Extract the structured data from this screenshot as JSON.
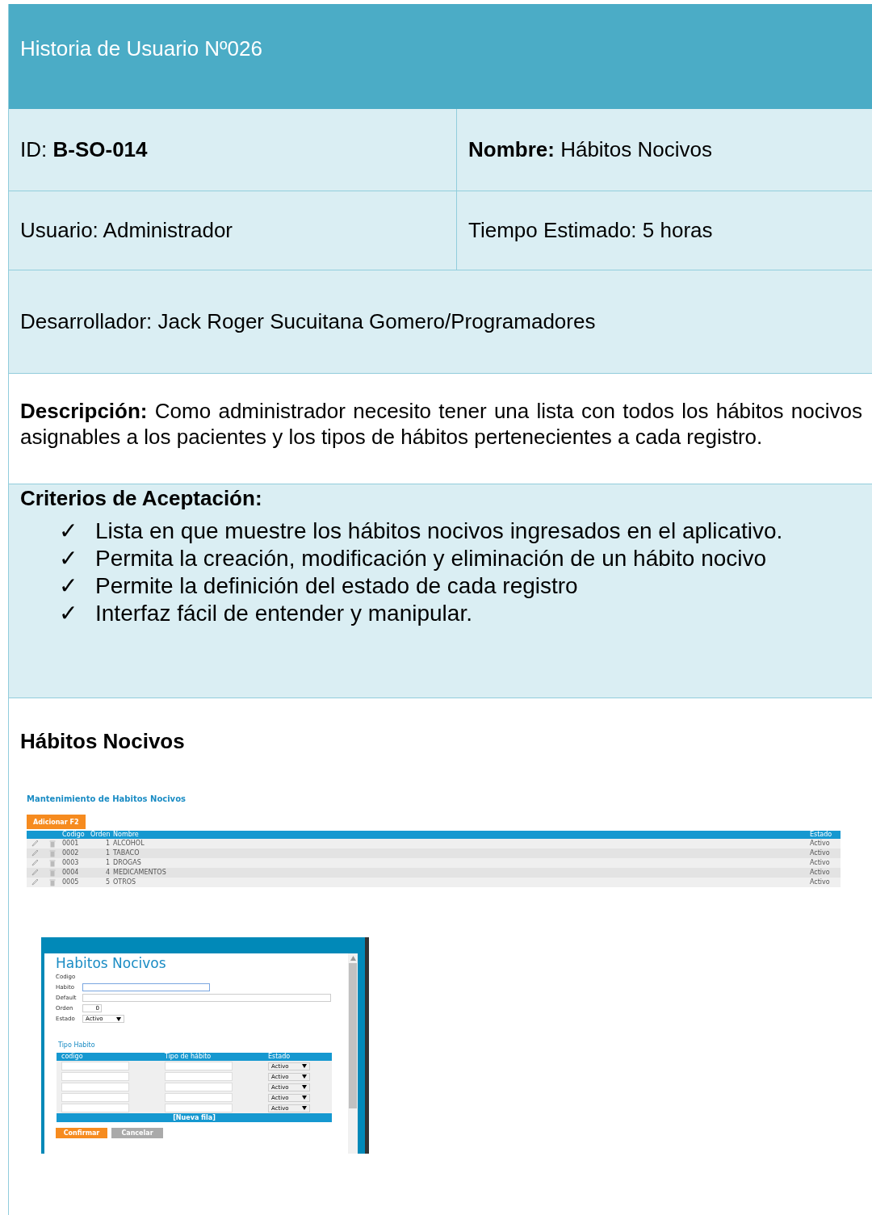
{
  "story": {
    "title": "Historia de Usuario Nº026",
    "id_label": "ID:",
    "id_value": "B-SO-014",
    "name_label": "Nombre:",
    "name_value": "Hábitos Nocivos",
    "user": "Usuario: Administrador",
    "time": "Tiempo Estimado: 5 horas",
    "developer": "Desarrollador: Jack Roger Sucuitana Gomero/Programadores",
    "description": "**Descripción:** Como administrador necesito tener una lista con todos los hábitos nocivos asignables a los pacientes y los tipos de hábitos pertenecientes a cada registro.",
    "criteria_title": "Criterios de Aceptación:",
    "criteria": [
      {
        "mark": "✓",
        "text": "Lista en que muestre los hábitos nocivos ingresados en el aplicativo."
      },
      {
        "mark": "✓",
        "text": "Permita la creación, modificación y eliminación de un hábito nocivo"
      },
      {
        "mark": "✓",
        "text": "Permite la definición del estado de cada registro"
      },
      {
        "mark": "✓",
        "text": "Interfaz fácil de entender y manipular."
      }
    ]
  },
  "prototype": {
    "title": "Hábitos Nocivos",
    "list_screen": {
      "title": "Mantenimiento de Habitos Nocivos",
      "add_button": "Adicionar F2",
      "columns": [
        "Codigo",
        "Orden",
        "Nombre",
        "Estado"
      ],
      "rows": [
        {
          "codigo": "0001",
          "orden": "1",
          "nombre": "ALCOHOL",
          "estado": "Activo"
        },
        {
          "codigo": "0002",
          "orden": "1",
          "nombre": "TABACO",
          "estado": "Activo"
        },
        {
          "codigo": "0003",
          "orden": "1",
          "nombre": "DROGAS",
          "estado": "Activo"
        },
        {
          "codigo": "0004",
          "orden": "4",
          "nombre": "MEDICAMENTOS",
          "estado": "Activo"
        },
        {
          "codigo": "0005",
          "orden": "5",
          "nombre": "OTROS",
          "estado": "Activo"
        }
      ]
    },
    "form_screen": {
      "title": "Habitos Nocivos",
      "fields": [
        {
          "kind": "caption",
          "label": "Codigo"
        },
        {
          "kind": "text",
          "label": "Habito",
          "focused": true
        },
        {
          "kind": "wide",
          "label": "Default",
          "focused": false
        },
        {
          "kind": "number",
          "label": "Orden",
          "value": "0"
        },
        {
          "kind": "select",
          "label": "Estado",
          "value": "Activo"
        }
      ],
      "section_title": "Tipo Habito",
      "columns": [
        "codigo",
        "Tipo de hábito",
        "Estado"
      ],
      "rows": [
        {
          "estado": "Activo"
        },
        {
          "estado": "Activo"
        },
        {
          "estado": "Activo"
        },
        {
          "estado": "Activo"
        },
        {
          "estado": "Activo"
        }
      ],
      "new_row": "[Nueva fila]",
      "buttons": [
        {
          "kind": "primary",
          "label": "Confirmar"
        },
        {
          "kind": "secondary",
          "label": "Cancelar"
        }
      ]
    }
  }
}
